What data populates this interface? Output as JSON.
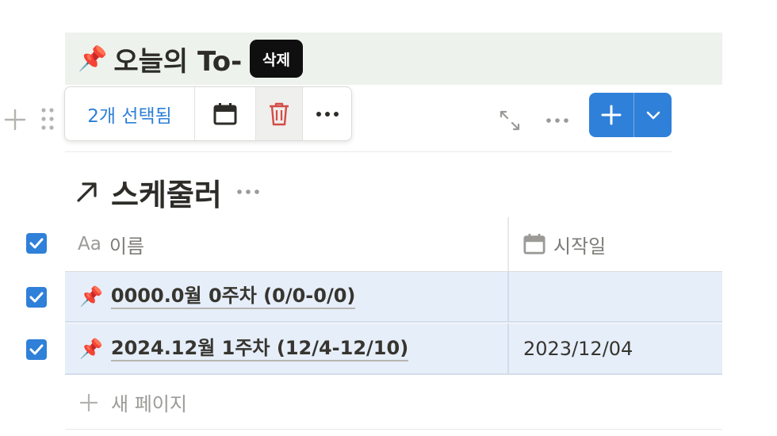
{
  "page": {
    "title_emoji": "📌",
    "title": "오늘의 To-"
  },
  "tooltip": {
    "label": "삭제"
  },
  "selection_toolbar": {
    "count_label": "2개 선택됨",
    "calendar_icon": "calendar-icon",
    "delete_icon": "trash-icon",
    "more_icon": "more-icon"
  },
  "actions": {
    "expand_icon": "expand-icon",
    "more_icon": "more-icon",
    "new_button_icon": "plus-icon",
    "new_dropdown_icon": "chevron-down-icon"
  },
  "database": {
    "title_icon": "arrow-up-right-icon",
    "title": "스케줄러",
    "columns": [
      {
        "icon_text": "Aa",
        "label": "이름"
      },
      {
        "icon": "calendar-icon",
        "label": "시작일"
      }
    ],
    "rows": [
      {
        "emoji": "📌",
        "name": "0000.0월 0주차 (0/0-0/0)",
        "start_date": "",
        "checked": true
      },
      {
        "emoji": "📌",
        "name": "2024.12월 1주차 (12/4-12/10)",
        "start_date": "2023/12/04",
        "checked": true
      }
    ],
    "new_page_label": "새 페이지"
  },
  "colors": {
    "accent": "#2f80d8",
    "title_band": "#edf3ec",
    "selected_row": "#e6eef9",
    "trash_red": "#d44c47"
  }
}
